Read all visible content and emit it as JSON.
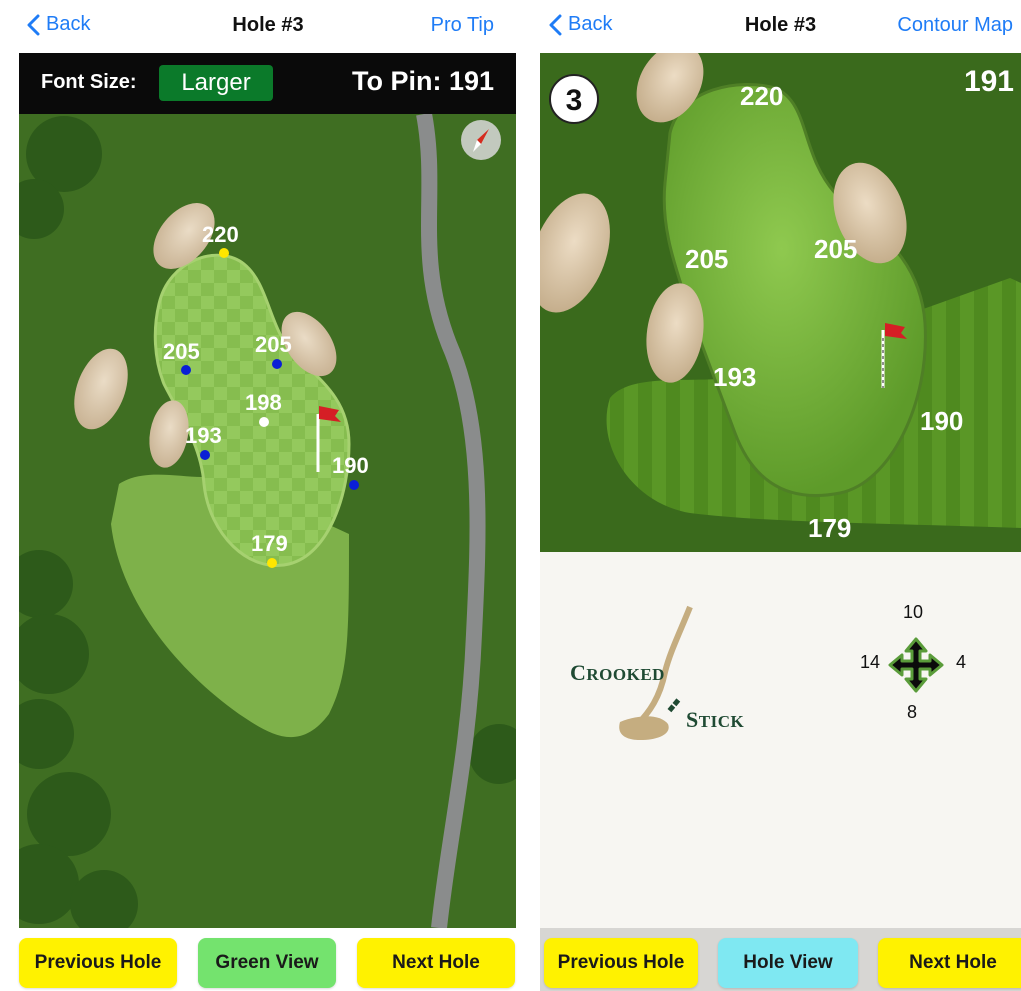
{
  "left": {
    "nav": {
      "back_label": "Back",
      "title": "Hole #3",
      "action_label": "Pro Tip"
    },
    "toolbar": {
      "font_size_label": "Font Size:",
      "font_size_value": "Larger",
      "to_pin_label": "To Pin: 191"
    },
    "distances": {
      "back": "220",
      "left_back": "205",
      "right_back": "205",
      "center": "198",
      "left_front": "193",
      "right": "190",
      "front": "179"
    },
    "buttons": {
      "previous": "Previous Hole",
      "view": "Green View",
      "next": "Next Hole"
    }
  },
  "right": {
    "nav": {
      "back_label": "Back",
      "title": "Hole #3",
      "action_label": "Contour Map"
    },
    "hole_number": "3",
    "to_pin": "191",
    "distances": {
      "back": "220",
      "left": "205",
      "right": "205",
      "left_front": "193",
      "right_side": "190",
      "front": "179"
    },
    "logo": {
      "word1_big": "C",
      "word1_rest": "ROOKED",
      "word2_big": "S",
      "word2_rest": "TICK"
    },
    "wind": {
      "north": "10",
      "west": "14",
      "east": "4",
      "south": "8"
    },
    "buttons": {
      "previous": "Previous Hole",
      "view": "Hole View",
      "next": "Next Hole"
    }
  },
  "colors": {
    "link": "#1f7cf6",
    "font_size_button": "#0b7a2a",
    "yellow_button": "#fff200",
    "green_button": "#74e36e",
    "cyan_button": "#7fe8f2",
    "logo_green": "#1f4a33"
  },
  "icons": [
    "back-chevron-icon",
    "compass-icon",
    "flag-icon",
    "wind-arrows-icon",
    "crooked-stick-logo"
  ]
}
